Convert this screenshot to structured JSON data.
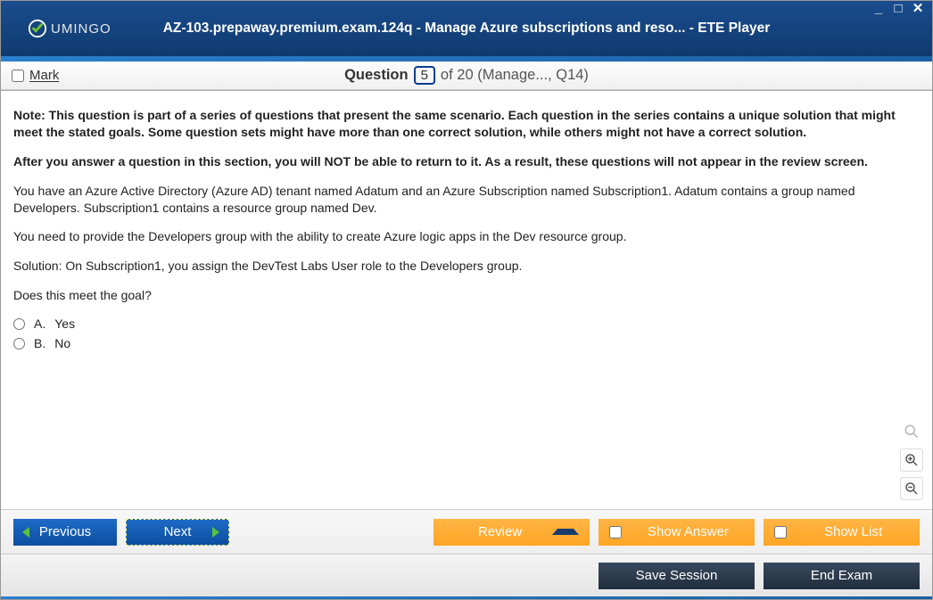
{
  "window": {
    "title": "AZ-103.prepaway.premium.exam.124q - Manage Azure subscriptions and reso... - ETE Player",
    "brand": "UMINGO"
  },
  "infobar": {
    "mark_label": "Mark",
    "question_label": "Question",
    "question_num": "5",
    "rest": "of 20 (Manage..., Q14)"
  },
  "question": {
    "note1": "Note: This question is part of a series of questions that present the same scenario. Each question in the series contains a unique solution that might meet the stated goals. Some question sets might have more than one correct solution, while others might not have a correct solution.",
    "note2": "After you answer a question in this section, you will NOT be able to return to it. As a result, these questions will not appear in the review screen.",
    "p1": "You have an Azure Active Directory (Azure AD) tenant named Adatum and an Azure Subscription named Subscription1. Adatum contains a group named Developers. Subscription1 contains a resource group named Dev.",
    "p2": "You need to provide the Developers group with the ability to create Azure logic apps in the Dev resource group.",
    "p3": "Solution: On Subscription1, you assign the DevTest Labs User role to the Developers group.",
    "p4": "Does this meet the goal?",
    "optA_letter": "A.",
    "optA_text": "Yes",
    "optB_letter": "B.",
    "optB_text": "No"
  },
  "buttons": {
    "previous": "Previous",
    "next": "Next",
    "review": "Review",
    "show_answer": "Show Answer",
    "show_list": "Show List",
    "save_session": "Save Session",
    "end_exam": "End Exam"
  }
}
